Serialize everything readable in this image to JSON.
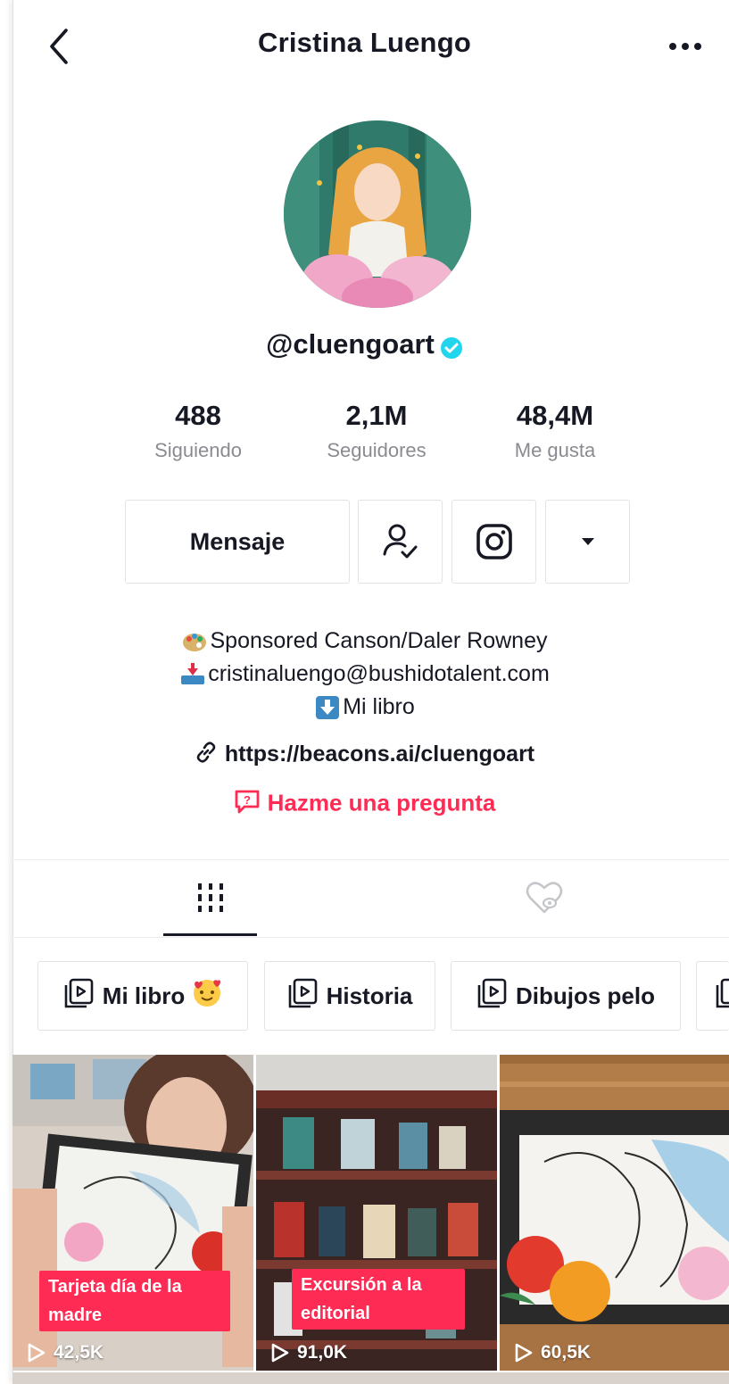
{
  "header": {
    "title": "Cristina Luengo",
    "back_icon": "chevron-left-icon",
    "more_icon": "more-horizontal-icon"
  },
  "profile": {
    "avatar": "illustrated-avatar",
    "handle": "@cluengoart",
    "verified_color": "#20d5ec",
    "stats": [
      {
        "value": "488",
        "label": "Siguiendo"
      },
      {
        "value": "2,1M",
        "label": "Seguidores"
      },
      {
        "value": "48,4M",
        "label": "Me gusta"
      }
    ]
  },
  "actions": {
    "message_label": "Mensaje",
    "following_icon": "person-check-icon",
    "instagram_icon": "instagram-icon",
    "dropdown_icon": "caret-down-icon"
  },
  "bio": {
    "lines": [
      "Sponsored Canson/Daler Rowney",
      "cristinaluengo@bushidotalent.com",
      "Mi libro"
    ],
    "link": "https://beacons.ai/cluengoart",
    "ask": "Hazme una pregunta",
    "accent_color": "#fe2c55"
  },
  "tabs": [
    {
      "icon": "grid-icon",
      "active": true
    },
    {
      "icon": "liked-hidden-icon",
      "active": false
    }
  ],
  "playlists": [
    {
      "label": "Mi libro"
    },
    {
      "label": "Historia"
    },
    {
      "label": "Dibujos pelo"
    }
  ],
  "videos": [
    {
      "caption": "Tarjeta día de la madre",
      "views": "42,5K"
    },
    {
      "caption": "Excursión a la editorial",
      "views": "91,0K"
    },
    {
      "caption": "",
      "views": "60,5K"
    }
  ]
}
